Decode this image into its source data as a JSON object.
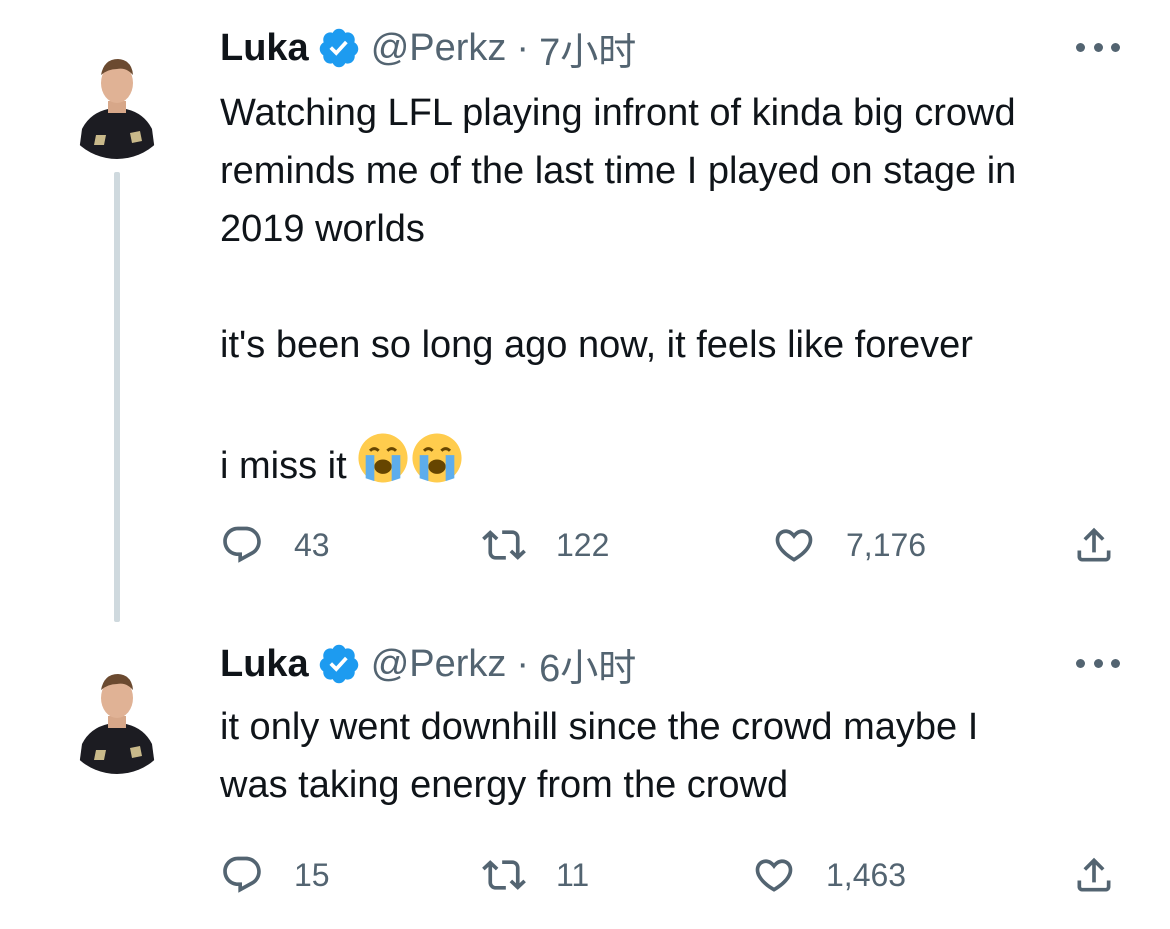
{
  "tweets": [
    {
      "author_name": "Luka",
      "handle": "@Perkz",
      "separator": "·",
      "time": "7小时",
      "text": "Watching LFL playing infront of kinda big crowd\nreminds me of the last time I played on stage in\n2019 worlds\n\nit's been so long ago now, it feels like forever\n\ni miss it",
      "text_emoji": [
        "loudly-crying-face",
        "loudly-crying-face"
      ],
      "stats": {
        "replies": "43",
        "retweets": "122",
        "likes": "7,176"
      }
    },
    {
      "author_name": "Luka",
      "handle": "@Perkz",
      "separator": "·",
      "time": "6小时",
      "text": "it only went downhill since the crowd maybe I\nwas taking energy from the crowd",
      "stats": {
        "replies": "15",
        "retweets": "11",
        "likes": "1,463"
      }
    }
  ],
  "icons": {
    "verified": "verified-badge-icon",
    "more": "more-icon",
    "reply": "reply-icon",
    "retweet": "retweet-icon",
    "like": "like-icon",
    "share": "share-icon"
  },
  "colors": {
    "text": "#0f1419",
    "secondary": "#536471",
    "verified": "#1d9bf0",
    "thread_line": "#cfd9de"
  }
}
